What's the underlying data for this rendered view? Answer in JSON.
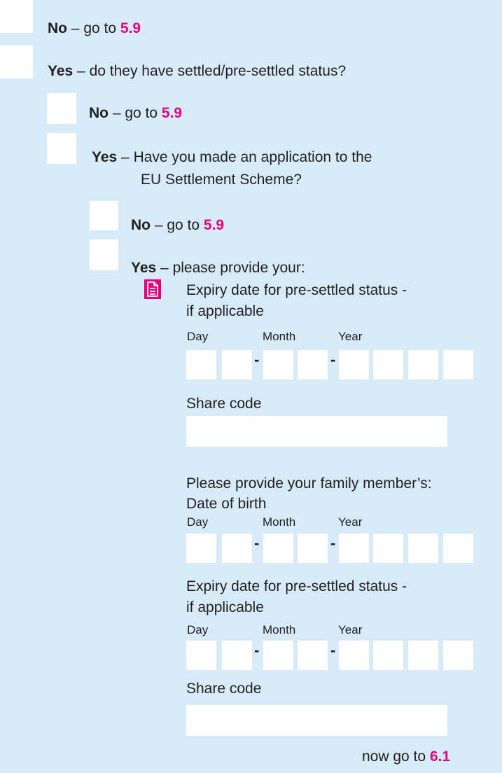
{
  "q1": {
    "no_label": "No",
    "no_text": " – go to ",
    "no_ref": "5.9",
    "yes_label": "Yes",
    "yes_text": " – do they have settled/pre-settled status?"
  },
  "q2": {
    "no_label": "No",
    "no_text": " – go to ",
    "no_ref": "5.9",
    "yes_label": "Yes",
    "yes_text_1": " – Have you made an application to the",
    "yes_text_2": "EU Settlement Scheme?"
  },
  "q3": {
    "no_label": "No",
    "no_text": " – go to ",
    "no_ref": "5.9",
    "yes_label": "Yes",
    "yes_text": " –  please provide your:"
  },
  "your_details": {
    "expiry_label_1": "Expiry date for pre-settled status -",
    "expiry_label_2": "if applicable",
    "share_code_label": "Share code"
  },
  "family": {
    "intro": "Please provide your family member’s:",
    "dob_label": "Date of birth",
    "expiry_label_1": "Expiry date for pre-settled status -",
    "expiry_label_2": "if applicable",
    "share_code_label": "Share code"
  },
  "date_parts": {
    "day": "Day",
    "month": "Month",
    "year": "Year",
    "separator": "-"
  },
  "footer": {
    "text": "now go to ",
    "ref": "6.1"
  },
  "colors": {
    "background": "#d6ebf7",
    "accent": "#e6007e",
    "box": "#ffffff"
  },
  "icons": {
    "document": "document-icon"
  }
}
